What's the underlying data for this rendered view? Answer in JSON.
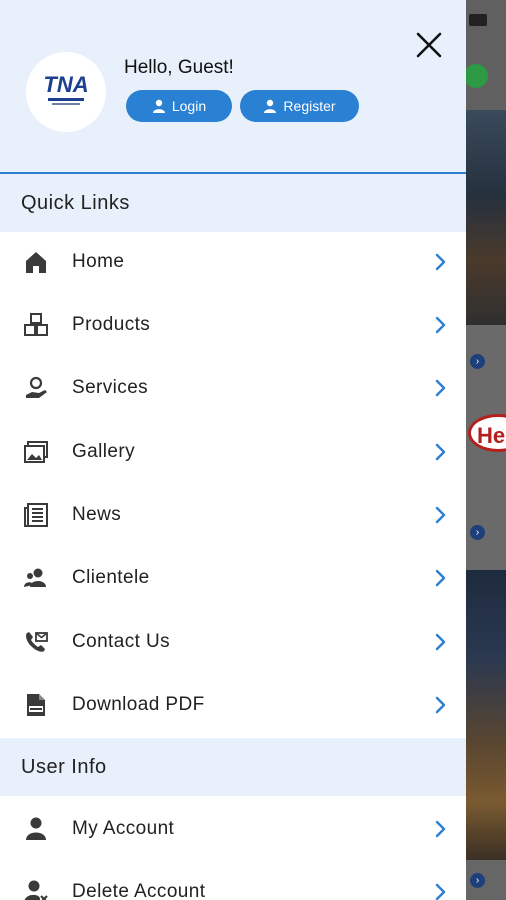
{
  "header": {
    "logo_text": "TNA",
    "greeting": "Hello, Guest!",
    "login_label": "Login",
    "register_label": "Register"
  },
  "quick_links": {
    "title": "Quick Links",
    "items": [
      {
        "label": "Home",
        "icon": "home-icon"
      },
      {
        "label": "Products",
        "icon": "boxes-icon"
      },
      {
        "label": "Services",
        "icon": "service-hand-icon"
      },
      {
        "label": "Gallery",
        "icon": "gallery-icon"
      },
      {
        "label": "News",
        "icon": "newspaper-icon"
      },
      {
        "label": "Clientele",
        "icon": "clients-icon"
      },
      {
        "label": "Contact Us",
        "icon": "phone-mail-icon"
      },
      {
        "label": "Download PDF",
        "icon": "pdf-file-icon"
      }
    ]
  },
  "user_info": {
    "title": "User Info",
    "items": [
      {
        "label": "My Account",
        "icon": "user-icon"
      },
      {
        "label": "Delete Account",
        "icon": "user-delete-icon"
      }
    ]
  },
  "background": {
    "badge_text": "He"
  },
  "colors": {
    "accent": "#2a80d2",
    "header_bg": "#e8f1fb",
    "icon": "#3a3a3a"
  }
}
